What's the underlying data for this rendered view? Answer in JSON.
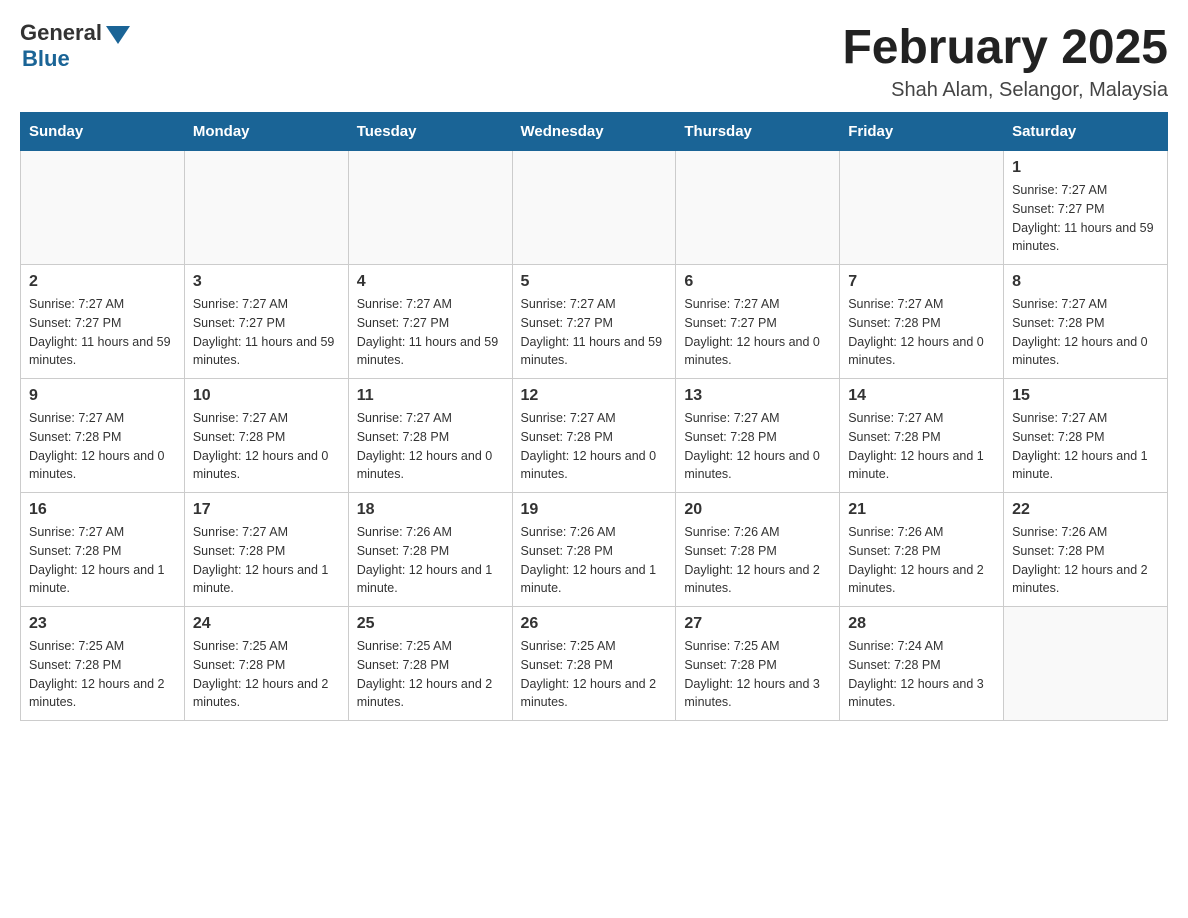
{
  "header": {
    "logo_general": "General",
    "logo_blue": "Blue",
    "month_title": "February 2025",
    "location": "Shah Alam, Selangor, Malaysia"
  },
  "days_of_week": [
    "Sunday",
    "Monday",
    "Tuesday",
    "Wednesday",
    "Thursday",
    "Friday",
    "Saturday"
  ],
  "weeks": [
    {
      "days": [
        {
          "number": "",
          "sunrise": "",
          "sunset": "",
          "daylight": "",
          "empty": true
        },
        {
          "number": "",
          "sunrise": "",
          "sunset": "",
          "daylight": "",
          "empty": true
        },
        {
          "number": "",
          "sunrise": "",
          "sunset": "",
          "daylight": "",
          "empty": true
        },
        {
          "number": "",
          "sunrise": "",
          "sunset": "",
          "daylight": "",
          "empty": true
        },
        {
          "number": "",
          "sunrise": "",
          "sunset": "",
          "daylight": "",
          "empty": true
        },
        {
          "number": "",
          "sunrise": "",
          "sunset": "",
          "daylight": "",
          "empty": true
        },
        {
          "number": "1",
          "sunrise": "Sunrise: 7:27 AM",
          "sunset": "Sunset: 7:27 PM",
          "daylight": "Daylight: 11 hours and 59 minutes.",
          "empty": false
        }
      ]
    },
    {
      "days": [
        {
          "number": "2",
          "sunrise": "Sunrise: 7:27 AM",
          "sunset": "Sunset: 7:27 PM",
          "daylight": "Daylight: 11 hours and 59 minutes.",
          "empty": false
        },
        {
          "number": "3",
          "sunrise": "Sunrise: 7:27 AM",
          "sunset": "Sunset: 7:27 PM",
          "daylight": "Daylight: 11 hours and 59 minutes.",
          "empty": false
        },
        {
          "number": "4",
          "sunrise": "Sunrise: 7:27 AM",
          "sunset": "Sunset: 7:27 PM",
          "daylight": "Daylight: 11 hours and 59 minutes.",
          "empty": false
        },
        {
          "number": "5",
          "sunrise": "Sunrise: 7:27 AM",
          "sunset": "Sunset: 7:27 PM",
          "daylight": "Daylight: 11 hours and 59 minutes.",
          "empty": false
        },
        {
          "number": "6",
          "sunrise": "Sunrise: 7:27 AM",
          "sunset": "Sunset: 7:27 PM",
          "daylight": "Daylight: 12 hours and 0 minutes.",
          "empty": false
        },
        {
          "number": "7",
          "sunrise": "Sunrise: 7:27 AM",
          "sunset": "Sunset: 7:28 PM",
          "daylight": "Daylight: 12 hours and 0 minutes.",
          "empty": false
        },
        {
          "number": "8",
          "sunrise": "Sunrise: 7:27 AM",
          "sunset": "Sunset: 7:28 PM",
          "daylight": "Daylight: 12 hours and 0 minutes.",
          "empty": false
        }
      ]
    },
    {
      "days": [
        {
          "number": "9",
          "sunrise": "Sunrise: 7:27 AM",
          "sunset": "Sunset: 7:28 PM",
          "daylight": "Daylight: 12 hours and 0 minutes.",
          "empty": false
        },
        {
          "number": "10",
          "sunrise": "Sunrise: 7:27 AM",
          "sunset": "Sunset: 7:28 PM",
          "daylight": "Daylight: 12 hours and 0 minutes.",
          "empty": false
        },
        {
          "number": "11",
          "sunrise": "Sunrise: 7:27 AM",
          "sunset": "Sunset: 7:28 PM",
          "daylight": "Daylight: 12 hours and 0 minutes.",
          "empty": false
        },
        {
          "number": "12",
          "sunrise": "Sunrise: 7:27 AM",
          "sunset": "Sunset: 7:28 PM",
          "daylight": "Daylight: 12 hours and 0 minutes.",
          "empty": false
        },
        {
          "number": "13",
          "sunrise": "Sunrise: 7:27 AM",
          "sunset": "Sunset: 7:28 PM",
          "daylight": "Daylight: 12 hours and 0 minutes.",
          "empty": false
        },
        {
          "number": "14",
          "sunrise": "Sunrise: 7:27 AM",
          "sunset": "Sunset: 7:28 PM",
          "daylight": "Daylight: 12 hours and 1 minute.",
          "empty": false
        },
        {
          "number": "15",
          "sunrise": "Sunrise: 7:27 AM",
          "sunset": "Sunset: 7:28 PM",
          "daylight": "Daylight: 12 hours and 1 minute.",
          "empty": false
        }
      ]
    },
    {
      "days": [
        {
          "number": "16",
          "sunrise": "Sunrise: 7:27 AM",
          "sunset": "Sunset: 7:28 PM",
          "daylight": "Daylight: 12 hours and 1 minute.",
          "empty": false
        },
        {
          "number": "17",
          "sunrise": "Sunrise: 7:27 AM",
          "sunset": "Sunset: 7:28 PM",
          "daylight": "Daylight: 12 hours and 1 minute.",
          "empty": false
        },
        {
          "number": "18",
          "sunrise": "Sunrise: 7:26 AM",
          "sunset": "Sunset: 7:28 PM",
          "daylight": "Daylight: 12 hours and 1 minute.",
          "empty": false
        },
        {
          "number": "19",
          "sunrise": "Sunrise: 7:26 AM",
          "sunset": "Sunset: 7:28 PM",
          "daylight": "Daylight: 12 hours and 1 minute.",
          "empty": false
        },
        {
          "number": "20",
          "sunrise": "Sunrise: 7:26 AM",
          "sunset": "Sunset: 7:28 PM",
          "daylight": "Daylight: 12 hours and 2 minutes.",
          "empty": false
        },
        {
          "number": "21",
          "sunrise": "Sunrise: 7:26 AM",
          "sunset": "Sunset: 7:28 PM",
          "daylight": "Daylight: 12 hours and 2 minutes.",
          "empty": false
        },
        {
          "number": "22",
          "sunrise": "Sunrise: 7:26 AM",
          "sunset": "Sunset: 7:28 PM",
          "daylight": "Daylight: 12 hours and 2 minutes.",
          "empty": false
        }
      ]
    },
    {
      "days": [
        {
          "number": "23",
          "sunrise": "Sunrise: 7:25 AM",
          "sunset": "Sunset: 7:28 PM",
          "daylight": "Daylight: 12 hours and 2 minutes.",
          "empty": false
        },
        {
          "number": "24",
          "sunrise": "Sunrise: 7:25 AM",
          "sunset": "Sunset: 7:28 PM",
          "daylight": "Daylight: 12 hours and 2 minutes.",
          "empty": false
        },
        {
          "number": "25",
          "sunrise": "Sunrise: 7:25 AM",
          "sunset": "Sunset: 7:28 PM",
          "daylight": "Daylight: 12 hours and 2 minutes.",
          "empty": false
        },
        {
          "number": "26",
          "sunrise": "Sunrise: 7:25 AM",
          "sunset": "Sunset: 7:28 PM",
          "daylight": "Daylight: 12 hours and 2 minutes.",
          "empty": false
        },
        {
          "number": "27",
          "sunrise": "Sunrise: 7:25 AM",
          "sunset": "Sunset: 7:28 PM",
          "daylight": "Daylight: 12 hours and 3 minutes.",
          "empty": false
        },
        {
          "number": "28",
          "sunrise": "Sunrise: 7:24 AM",
          "sunset": "Sunset: 7:28 PM",
          "daylight": "Daylight: 12 hours and 3 minutes.",
          "empty": false
        },
        {
          "number": "",
          "sunrise": "",
          "sunset": "",
          "daylight": "",
          "empty": true
        }
      ]
    }
  ]
}
